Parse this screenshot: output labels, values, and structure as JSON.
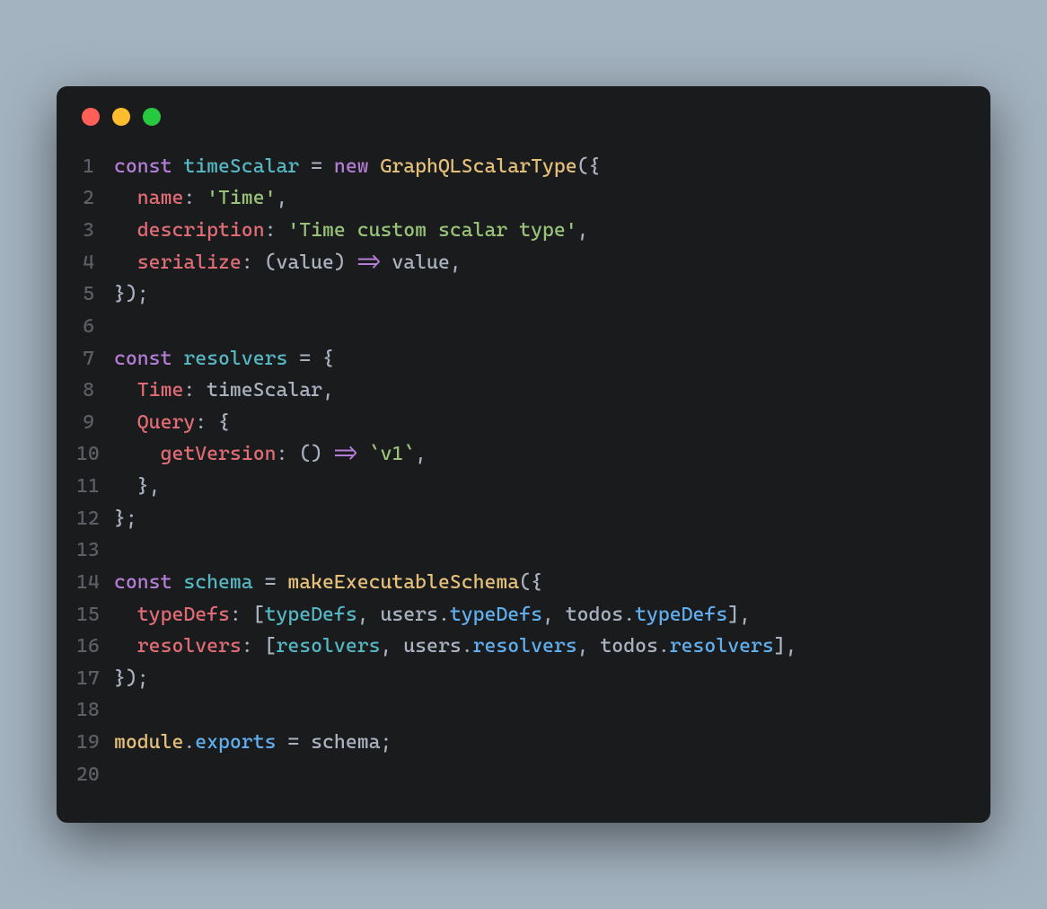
{
  "window": {
    "dots": [
      "red",
      "yellow",
      "green"
    ]
  },
  "code": {
    "lines": [
      {
        "n": "1",
        "tokens": [
          {
            "t": "const ",
            "c": "kw"
          },
          {
            "t": "timeScalar",
            "c": "va"
          },
          {
            "t": " ",
            "c": "pn"
          },
          {
            "t": "=",
            "c": "pn"
          },
          {
            "t": " ",
            "c": "pn"
          },
          {
            "t": "new",
            "c": "kw"
          },
          {
            "t": " ",
            "c": "pn"
          },
          {
            "t": "GraphQLScalarType",
            "c": "fn"
          },
          {
            "t": "({",
            "c": "pn"
          }
        ]
      },
      {
        "n": "2",
        "tokens": [
          {
            "t": "  ",
            "c": "pn"
          },
          {
            "t": "name",
            "c": "pr"
          },
          {
            "t": ": ",
            "c": "pn"
          },
          {
            "t": "'Time'",
            "c": "st"
          },
          {
            "t": ",",
            "c": "pn"
          }
        ]
      },
      {
        "n": "3",
        "tokens": [
          {
            "t": "  ",
            "c": "pn"
          },
          {
            "t": "description",
            "c": "pr"
          },
          {
            "t": ": ",
            "c": "pn"
          },
          {
            "t": "'Time custom scalar type'",
            "c": "st"
          },
          {
            "t": ",",
            "c": "pn"
          }
        ]
      },
      {
        "n": "4",
        "tokens": [
          {
            "t": "  ",
            "c": "pn"
          },
          {
            "t": "serialize",
            "c": "pr"
          },
          {
            "t": ": (",
            "c": "pn"
          },
          {
            "t": "value",
            "c": "ar"
          },
          {
            "t": ") ",
            "c": "pn"
          },
          {
            "t": "=>",
            "c": "kw"
          },
          {
            "t": " value,",
            "c": "pn"
          }
        ]
      },
      {
        "n": "5",
        "tokens": [
          {
            "t": "});",
            "c": "pn"
          }
        ]
      },
      {
        "n": "6",
        "tokens": []
      },
      {
        "n": "7",
        "tokens": [
          {
            "t": "const ",
            "c": "kw"
          },
          {
            "t": "resolvers",
            "c": "va"
          },
          {
            "t": " ",
            "c": "pn"
          },
          {
            "t": "=",
            "c": "pn"
          },
          {
            "t": " {",
            "c": "pn"
          }
        ]
      },
      {
        "n": "8",
        "tokens": [
          {
            "t": "  ",
            "c": "pn"
          },
          {
            "t": "Time",
            "c": "pr"
          },
          {
            "t": ": timeScalar,",
            "c": "pn"
          }
        ]
      },
      {
        "n": "9",
        "tokens": [
          {
            "t": "  ",
            "c": "pn"
          },
          {
            "t": "Query",
            "c": "pr"
          },
          {
            "t": ": {",
            "c": "pn"
          }
        ]
      },
      {
        "n": "10",
        "tokens": [
          {
            "t": "    ",
            "c": "pn"
          },
          {
            "t": "getVersion",
            "c": "pr"
          },
          {
            "t": ": () ",
            "c": "pn"
          },
          {
            "t": "=>",
            "c": "kw"
          },
          {
            "t": " ",
            "c": "pn"
          },
          {
            "t": "`v1`",
            "c": "st"
          },
          {
            "t": ",",
            "c": "pn"
          }
        ]
      },
      {
        "n": "11",
        "tokens": [
          {
            "t": "  },",
            "c": "pn"
          }
        ]
      },
      {
        "n": "12",
        "tokens": [
          {
            "t": "};",
            "c": "pn"
          }
        ]
      },
      {
        "n": "13",
        "tokens": []
      },
      {
        "n": "14",
        "tokens": [
          {
            "t": "const ",
            "c": "kw"
          },
          {
            "t": "schema",
            "c": "va"
          },
          {
            "t": " ",
            "c": "pn"
          },
          {
            "t": "=",
            "c": "pn"
          },
          {
            "t": " ",
            "c": "pn"
          },
          {
            "t": "makeExecutableSchema",
            "c": "fn"
          },
          {
            "t": "({",
            "c": "pn"
          }
        ]
      },
      {
        "n": "15",
        "tokens": [
          {
            "t": "  ",
            "c": "pn"
          },
          {
            "t": "typeDefs",
            "c": "pr"
          },
          {
            "t": ": [",
            "c": "pn"
          },
          {
            "t": "typeDefs",
            "c": "va"
          },
          {
            "t": ", users.",
            "c": "pn"
          },
          {
            "t": "typeDefs",
            "c": "me"
          },
          {
            "t": ", todos.",
            "c": "pn"
          },
          {
            "t": "typeDefs",
            "c": "me"
          },
          {
            "t": "],",
            "c": "pn"
          }
        ]
      },
      {
        "n": "16",
        "tokens": [
          {
            "t": "  ",
            "c": "pn"
          },
          {
            "t": "resolvers",
            "c": "pr"
          },
          {
            "t": ": [",
            "c": "pn"
          },
          {
            "t": "resolvers",
            "c": "va"
          },
          {
            "t": ", users.",
            "c": "pn"
          },
          {
            "t": "resolvers",
            "c": "me"
          },
          {
            "t": ", todos.",
            "c": "pn"
          },
          {
            "t": "resolvers",
            "c": "me"
          },
          {
            "t": "],",
            "c": "pn"
          }
        ]
      },
      {
        "n": "17",
        "tokens": [
          {
            "t": "});",
            "c": "pn"
          }
        ]
      },
      {
        "n": "18",
        "tokens": []
      },
      {
        "n": "19",
        "tokens": [
          {
            "t": "module",
            "c": "ob"
          },
          {
            "t": ".",
            "c": "pn"
          },
          {
            "t": "exports",
            "c": "me"
          },
          {
            "t": " ",
            "c": "pn"
          },
          {
            "t": "=",
            "c": "pn"
          },
          {
            "t": " schema;",
            "c": "pn"
          }
        ]
      },
      {
        "n": "20",
        "tokens": []
      }
    ]
  }
}
